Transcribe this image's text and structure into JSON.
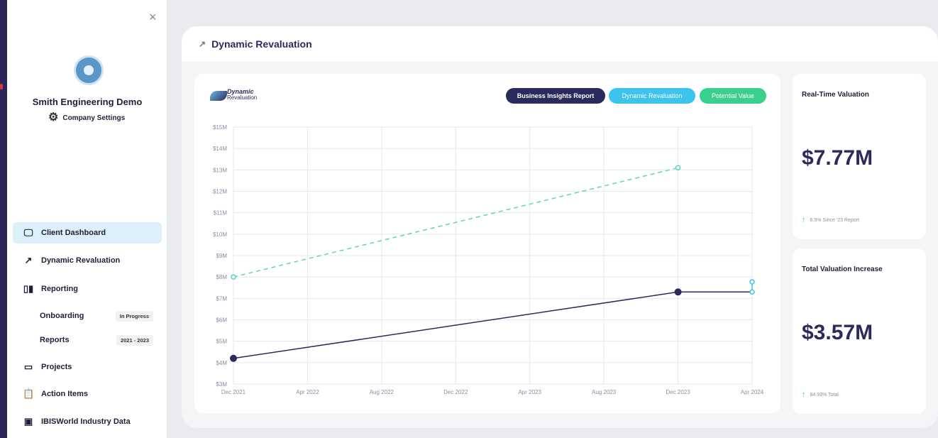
{
  "sidebar": {
    "company_name": "Smith Engineering Demo",
    "company_settings": "Company Settings",
    "close_icon": "×",
    "nav": [
      {
        "label": "Client Dashboard",
        "icon": "monitor-icon"
      },
      {
        "label": "Dynamic Revaluation",
        "icon": "trend-up-icon"
      },
      {
        "label": "Reporting",
        "icon": "bar-chart-icon"
      },
      {
        "label": "Projects",
        "icon": "document-icon"
      },
      {
        "label": "Action Items",
        "icon": "clipboard-icon"
      },
      {
        "label": "IBISWorld Industry Data",
        "icon": "presentation-icon"
      }
    ],
    "sub": [
      {
        "label": "Onboarding",
        "badge": "In Progress"
      },
      {
        "label": "Reports",
        "badge": "2021 - 2023"
      }
    ]
  },
  "main": {
    "title": "Dynamic Revaluation"
  },
  "chart_logo": {
    "line1": "Dynamic",
    "line2": "Revaluation"
  },
  "legend": {
    "bir": "Business Insights Report",
    "dr": "Dynamic Revaluation",
    "pv": "Potential Value"
  },
  "colors": {
    "business_insights": "#2b2a5c",
    "dynamic_revaluation": "#3cc3ee",
    "potential_value": "#3bcf8e",
    "potential_line": "#5fd3c0"
  },
  "cards": {
    "realtime": {
      "title": "Real-Time Valuation",
      "value": "$7.77M",
      "foot": "6.5% Since '23 Report"
    },
    "increase": {
      "title": "Total Valuation Increase",
      "value": "$3.57M",
      "foot": "84.93% Total"
    }
  },
  "chart_data": {
    "type": "line",
    "x": [
      "Dec 2021",
      "Apr 2022",
      "Aug 2022",
      "Dec 2022",
      "Apr 2023",
      "Aug 2023",
      "Dec 2023",
      "Apr 2024"
    ],
    "y_ticks": [
      "$3M",
      "$4M",
      "$5M",
      "$6M",
      "$7M",
      "$8M",
      "$9M",
      "$10M",
      "$11M",
      "$12M",
      "$13M",
      "$14M",
      "$15M"
    ],
    "ylim": [
      3,
      15
    ],
    "series": [
      {
        "name": "Business Insights Report",
        "points": [
          {
            "x": "Dec 2021",
            "y": 4.2
          },
          {
            "x": "Dec 2023",
            "y": 7.3
          }
        ]
      },
      {
        "name": "Dynamic Revaluation",
        "points": [
          {
            "x": "Dec 2023",
            "y": 7.3
          },
          {
            "x": "Apr 2024",
            "y": 7.3
          },
          {
            "x": "Apr 2024",
            "y": 7.77
          }
        ]
      },
      {
        "name": "Potential Value",
        "points": [
          {
            "x": "Dec 2021",
            "y": 8.0
          },
          {
            "x": "Dec 2023",
            "y": 13.1
          }
        ]
      }
    ]
  }
}
